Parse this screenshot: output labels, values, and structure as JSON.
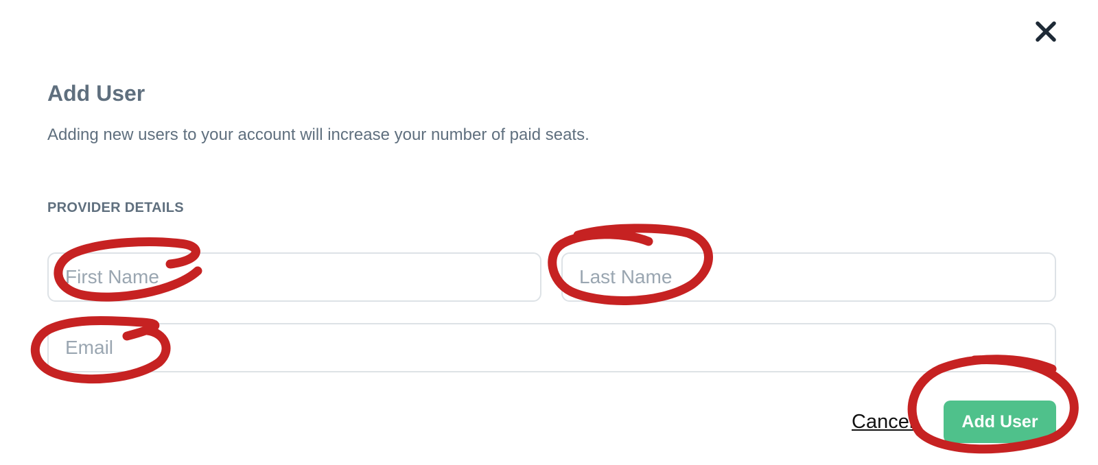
{
  "dialog": {
    "title": "Add User",
    "subtitle": "Adding new users to your account will increase your number of paid seats.",
    "close_icon": "close-icon",
    "section_label": "PROVIDER DETAILS"
  },
  "form": {
    "first_name": {
      "placeholder": "First Name",
      "value": ""
    },
    "last_name": {
      "placeholder": "Last Name",
      "value": ""
    },
    "email": {
      "placeholder": "Email",
      "value": ""
    }
  },
  "actions": {
    "cancel_label": "Cancel",
    "submit_label": "Add User"
  },
  "colors": {
    "text": "#5f6f7e",
    "border": "#dde2e6",
    "placeholder": "#9aa6b1",
    "primary_button": "#4fc18b",
    "annotation": "#c62222"
  }
}
